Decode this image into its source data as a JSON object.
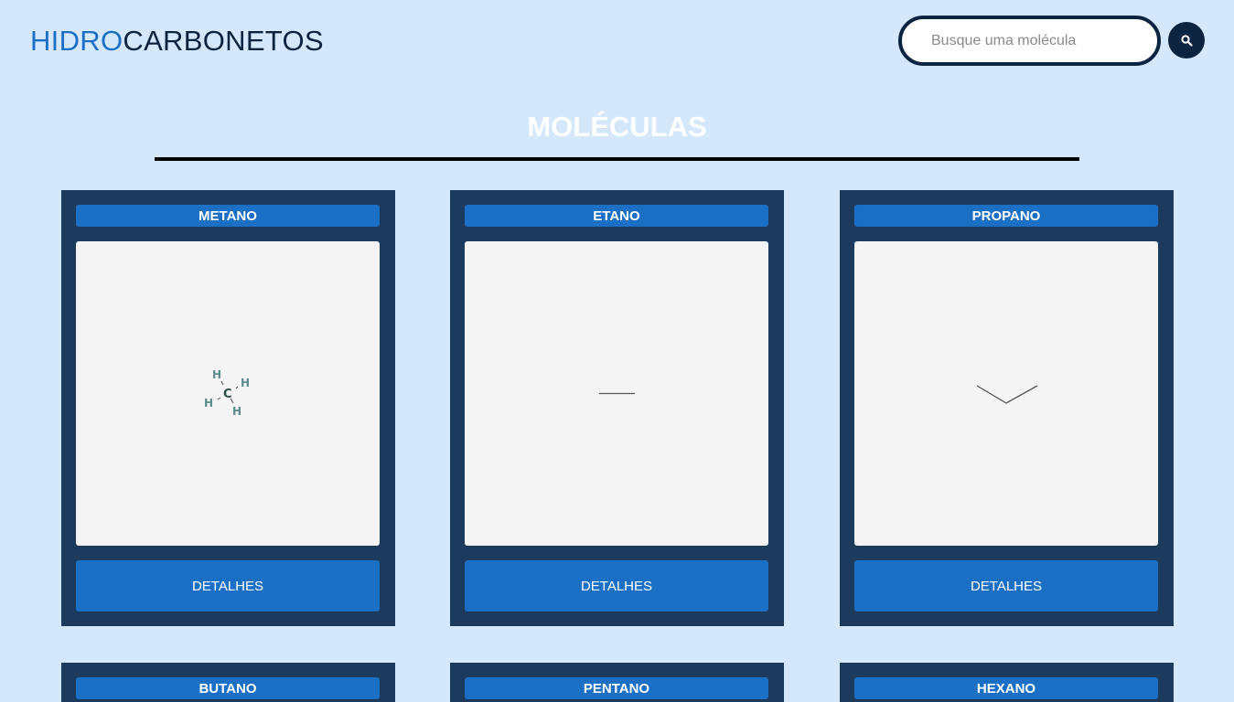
{
  "header": {
    "logo_part1": "HIDRO",
    "logo_part2": "CARBONETOS",
    "search_placeholder": "Busque uma molécula",
    "search_icon": "search-icon"
  },
  "main": {
    "title": "MOLÉCULAS"
  },
  "molecules": [
    {
      "name": "METANO",
      "button": "DETALHES",
      "image": "methane-structure",
      "atom_labels": {
        "carbon": "C",
        "hydrogen": "H"
      }
    },
    {
      "name": "ETANO",
      "button": "DETALHES",
      "image": "ethane-skeletal"
    },
    {
      "name": "PROPANO",
      "button": "DETALHES",
      "image": "propane-skeletal"
    },
    {
      "name": "BUTANO"
    },
    {
      "name": "PENTANO"
    },
    {
      "name": "HEXANO"
    }
  ],
  "colors": {
    "background": "#d4e7fb",
    "dark_navy": "#0d2440",
    "card": "#1b3a5c",
    "accent_blue": "#1b6fc5",
    "image_bg": "#f4f4f4"
  }
}
